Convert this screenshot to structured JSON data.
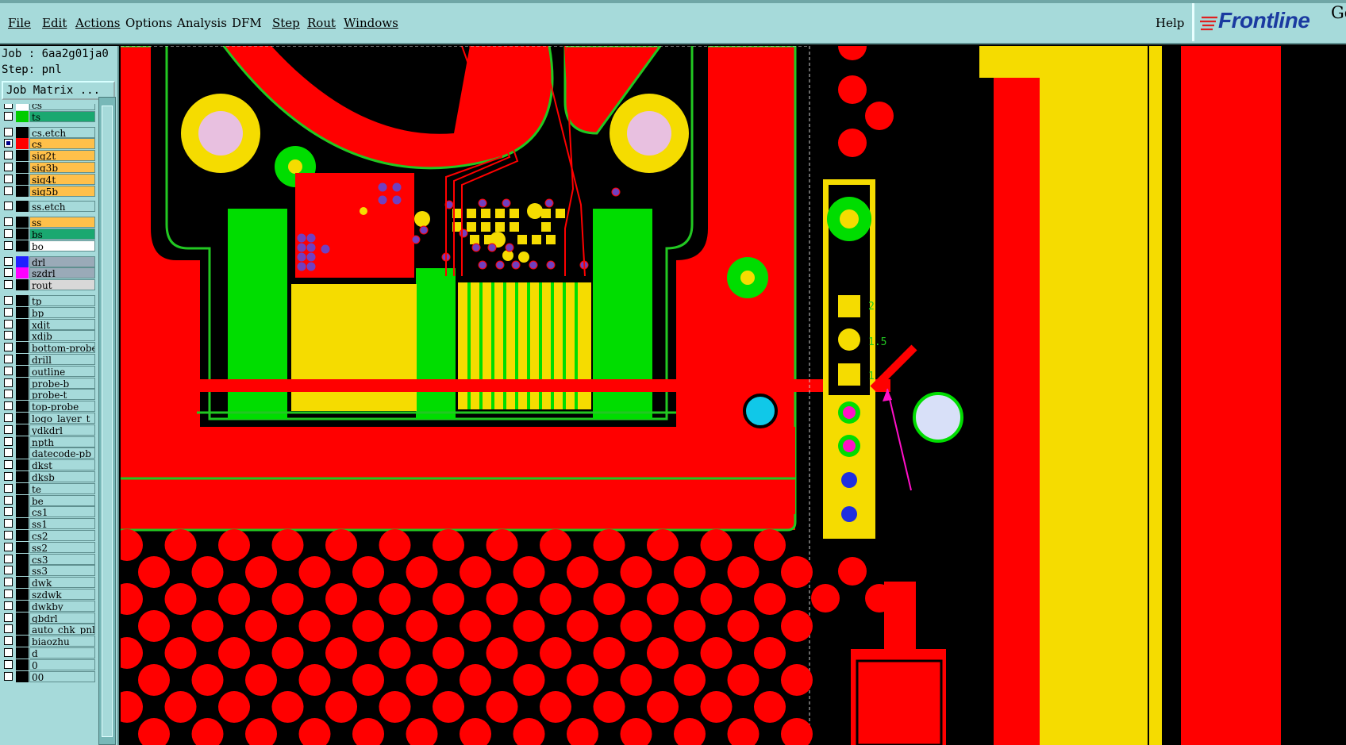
{
  "menu": {
    "items": [
      {
        "label": "File",
        "key": "file"
      },
      {
        "label": "Edit",
        "key": "edit"
      },
      {
        "label": "Actions",
        "key": "actions"
      },
      {
        "label": "Options",
        "key": "options"
      },
      {
        "label": "Analysis",
        "key": "analysis"
      },
      {
        "label": "DFM",
        "key": "dfm"
      },
      {
        "label": "Step",
        "key": "step"
      },
      {
        "label": "Rout",
        "key": "rout"
      },
      {
        "label": "Windows",
        "key": "windows"
      }
    ],
    "help_label": "Help"
  },
  "brand": {
    "name": "Frontline",
    "suffix": "Ge"
  },
  "job": {
    "job_text": "Job : 6aa2g01ja0",
    "step_text": "Step: pnl"
  },
  "job_matrix_label": "Job Matrix ...",
  "layers": [
    {
      "name": "cs",
      "color": "#ffffff",
      "bg": "#a6dada",
      "checked": false
    },
    {
      "name": "ts",
      "color": "#00cc00",
      "bg": "#1aa870",
      "checked": false
    },
    {
      "name": "cs.etch",
      "color": "#000000",
      "bg": "#a6dada",
      "checked": false
    },
    {
      "name": "cs",
      "color": "#ff0000",
      "bg": "#ffc04a",
      "checked": true
    },
    {
      "name": "sig2t",
      "color": "#000000",
      "bg": "#ffc04a",
      "checked": false
    },
    {
      "name": "sig3b",
      "color": "#000000",
      "bg": "#ffc04a",
      "checked": false
    },
    {
      "name": "sig4t",
      "color": "#000000",
      "bg": "#ffc04a",
      "checked": false
    },
    {
      "name": "sig5b",
      "color": "#000000",
      "bg": "#ffc04a",
      "checked": false
    },
    {
      "name": "ss.etch",
      "color": "#000000",
      "bg": "#a6dada",
      "checked": false
    },
    {
      "name": "ss",
      "color": "#000000",
      "bg": "#ffc04a",
      "checked": false
    },
    {
      "name": "bs",
      "color": "#000000",
      "bg": "#1aa870",
      "checked": false
    },
    {
      "name": "bo",
      "color": "#000000",
      "bg": "#ffffff",
      "checked": false
    },
    {
      "name": "drl",
      "color": "#2020ff",
      "bg": "#9aaab8",
      "checked": false
    },
    {
      "name": "szdrl",
      "color": "#ff00ff",
      "bg": "#9aaab8",
      "checked": false
    },
    {
      "name": "rout",
      "color": "#000000",
      "bg": "#d8d8d8",
      "checked": false
    },
    {
      "name": "tp",
      "color": "#000000",
      "bg": "#a6dada",
      "checked": false
    },
    {
      "name": "bp",
      "color": "#000000",
      "bg": "#a6dada",
      "checked": false
    },
    {
      "name": "xdjt",
      "color": "#000000",
      "bg": "#a6dada",
      "checked": false
    },
    {
      "name": "xdjb",
      "color": "#000000",
      "bg": "#a6dada",
      "checked": false
    },
    {
      "name": "bottom-probe",
      "color": "#000000",
      "bg": "#a6dada",
      "checked": false
    },
    {
      "name": "drill",
      "color": "#000000",
      "bg": "#a6dada",
      "checked": false
    },
    {
      "name": "outline",
      "color": "#000000",
      "bg": "#a6dada",
      "checked": false
    },
    {
      "name": "probe-b",
      "color": "#000000",
      "bg": "#a6dada",
      "checked": false
    },
    {
      "name": "probe-t",
      "color": "#000000",
      "bg": "#a6dada",
      "checked": false
    },
    {
      "name": "top-probe",
      "color": "#000000",
      "bg": "#a6dada",
      "checked": false
    },
    {
      "name": "logo_layer_t",
      "color": "#000000",
      "bg": "#a6dada",
      "checked": false
    },
    {
      "name": "ydkdrl",
      "color": "#000000",
      "bg": "#a6dada",
      "checked": false
    },
    {
      "name": "npth",
      "color": "#000000",
      "bg": "#a6dada",
      "checked": false
    },
    {
      "name": "datecode-pb",
      "color": "#000000",
      "bg": "#a6dada",
      "checked": false
    },
    {
      "name": "dkst",
      "color": "#000000",
      "bg": "#a6dada",
      "checked": false
    },
    {
      "name": "dksb",
      "color": "#000000",
      "bg": "#a6dada",
      "checked": false
    },
    {
      "name": "te",
      "color": "#000000",
      "bg": "#a6dada",
      "checked": false
    },
    {
      "name": "be",
      "color": "#000000",
      "bg": "#a6dada",
      "checked": false
    },
    {
      "name": "cs1",
      "color": "#000000",
      "bg": "#a6dada",
      "checked": false
    },
    {
      "name": "ss1",
      "color": "#000000",
      "bg": "#a6dada",
      "checked": false
    },
    {
      "name": "cs2",
      "color": "#000000",
      "bg": "#a6dada",
      "checked": false
    },
    {
      "name": "ss2",
      "color": "#000000",
      "bg": "#a6dada",
      "checked": false
    },
    {
      "name": "cs3",
      "color": "#000000",
      "bg": "#a6dada",
      "checked": false
    },
    {
      "name": "ss3",
      "color": "#000000",
      "bg": "#a6dada",
      "checked": false
    },
    {
      "name": "dwk",
      "color": "#000000",
      "bg": "#a6dada",
      "checked": false
    },
    {
      "name": "szdwk",
      "color": "#000000",
      "bg": "#a6dada",
      "checked": false
    },
    {
      "name": "dwkby",
      "color": "#000000",
      "bg": "#a6dada",
      "checked": false
    },
    {
      "name": "gbdrl",
      "color": "#000000",
      "bg": "#a6dada",
      "checked": false
    },
    {
      "name": "auto_chk_pnl",
      "color": "#000000",
      "bg": "#a6dada",
      "checked": false
    },
    {
      "name": "biaozhu",
      "color": "#000000",
      "bg": "#a6dada",
      "checked": false
    },
    {
      "name": "d",
      "color": "#000000",
      "bg": "#a6dada",
      "checked": false
    },
    {
      "name": "0",
      "color": "#000000",
      "bg": "#a6dada",
      "checked": false
    },
    {
      "name": "00",
      "color": "#000000",
      "bg": "#a6dada",
      "checked": false
    }
  ],
  "canvas": {
    "pad_labels": [
      "2",
      "1.5",
      "1"
    ],
    "colors": {
      "copper": "#ff0000",
      "mask": "#00dd00",
      "pad": "#f5dc00",
      "drill": "#1f2fe0",
      "via_pink": "#ff10c8",
      "cyan": "#10c8e8",
      "background": "#000000",
      "outline": "#22c822"
    }
  }
}
